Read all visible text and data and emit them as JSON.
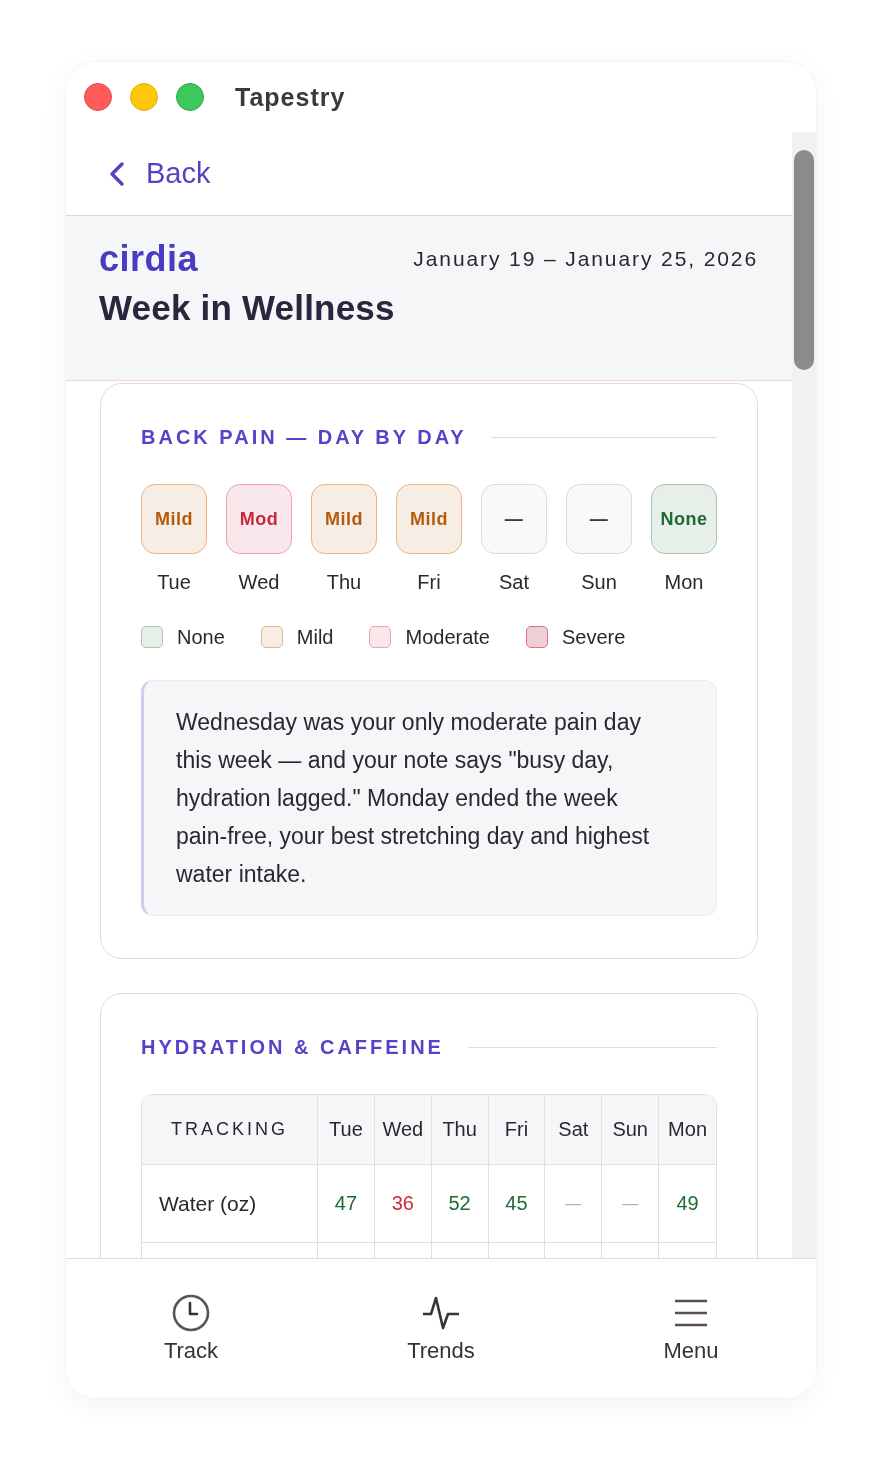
{
  "window": {
    "title": "Tapestry"
  },
  "navigation": {
    "back": "Back"
  },
  "header": {
    "brand": "cirdia",
    "date_range": "January 19 – January 25, 2026",
    "title": "Week in Wellness"
  },
  "back_pain": {
    "title": "BACK PAIN — DAY BY DAY",
    "days": [
      {
        "label": "Mild",
        "day": "Tue",
        "kind": "mild"
      },
      {
        "label": "Mod",
        "day": "Wed",
        "kind": "moderate"
      },
      {
        "label": "Mild",
        "day": "Thu",
        "kind": "mild"
      },
      {
        "label": "Mild",
        "day": "Fri",
        "kind": "mild"
      },
      {
        "label": "—",
        "day": "Sat",
        "kind": "empty"
      },
      {
        "label": "—",
        "day": "Sun",
        "kind": "empty"
      },
      {
        "label": "None",
        "day": "Mon",
        "kind": "none"
      }
    ],
    "legend": [
      {
        "label": "None",
        "kind": "none"
      },
      {
        "label": "Mild",
        "kind": "mild"
      },
      {
        "label": "Moderate",
        "kind": "moderate"
      },
      {
        "label": "Severe",
        "kind": "severe"
      }
    ],
    "insight": "Wednesday was your only moderate pain day this week — and your note says \"busy day, hydration lagged.\" Monday ended the week pain-free, your best stretching day and highest water intake."
  },
  "hydration": {
    "title": "HYDRATION & CAFFEINE",
    "columns": [
      "TRACKING",
      "Tue",
      "Wed",
      "Thu",
      "Fri",
      "Sat",
      "Sun",
      "Mon"
    ],
    "rows": [
      {
        "cells": [
          {
            "text": "Water (oz)",
            "kind": "label"
          },
          {
            "text": "47",
            "kind": "good"
          },
          {
            "text": "36",
            "kind": "low"
          },
          {
            "text": "52",
            "kind": "good"
          },
          {
            "text": "45",
            "kind": "good"
          },
          {
            "text": "—",
            "kind": "empty"
          },
          {
            "text": "—",
            "kind": "empty"
          },
          {
            "text": "49",
            "kind": "good"
          }
        ]
      }
    ]
  },
  "bottom_nav": [
    {
      "label": "Track",
      "kind": "clock"
    },
    {
      "label": "Trends",
      "kind": "pulse"
    },
    {
      "label": "Menu",
      "kind": "menu"
    }
  ]
}
